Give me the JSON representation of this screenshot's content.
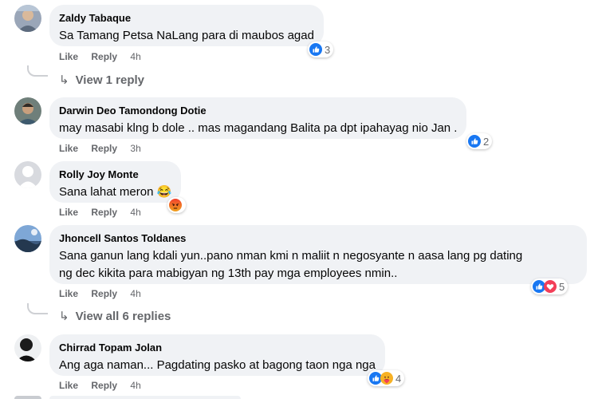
{
  "comments": [
    {
      "author": "Zaldy Tabaque",
      "text": "Sa Tamang Petsa NaLang para di maubos agad",
      "like_label": "Like",
      "reply_label": "Reply",
      "time": "4h",
      "reaction_icons": [
        "like-icon"
      ],
      "reaction_count": "3",
      "view_replies": "View 1 reply"
    },
    {
      "author": "Darwin Deo Tamondong Dotie",
      "text": "may masabi klng b dole .. mas magandang Balita pa dpt ipahayag nio Jan .",
      "like_label": "Like",
      "reply_label": "Reply",
      "time": "3h",
      "reaction_icons": [
        "like-icon"
      ],
      "reaction_count": "2"
    },
    {
      "author": "Rolly Joy Monte",
      "text": "Sana lahat meron 😂",
      "like_label": "Like",
      "reply_label": "Reply",
      "time": "4h",
      "reaction_icons": [
        "angry-icon"
      ],
      "reaction_count": ""
    },
    {
      "author": "Jhoncell Santos Toldanes",
      "text_lines": [
        "Sana ganun lang kdali yun..pano nman kmi n maliit n negosyante n aasa lang pg dating",
        "ng dec kikita para mabigyan ng 13th pay mga employees nmin.."
      ],
      "like_label": "Like",
      "reply_label": "Reply",
      "time": "4h",
      "reaction_icons": [
        "like-icon",
        "love-icon"
      ],
      "reaction_count": "5",
      "view_replies": "View all 6 replies"
    },
    {
      "author": "Chirrad Topam Jolan",
      "text": "Ang aga naman... Pagdating pasko at bagong taon nga nga",
      "like_label": "Like",
      "reply_label": "Reply",
      "time": "4h",
      "reaction_icons": [
        "like-icon",
        "care-icon"
      ],
      "reaction_count": "4"
    }
  ],
  "colors": {
    "bubble": "#f0f2f5",
    "meta_text": "#65676b",
    "like_blue": "#1877f2",
    "love_red": "#f33e58",
    "angry_orange": "#e9710f"
  }
}
